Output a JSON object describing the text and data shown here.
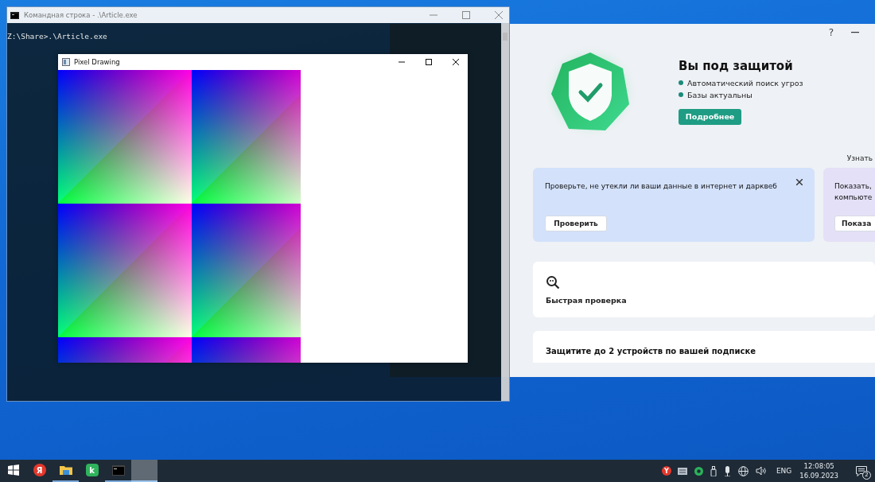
{
  "console_window": {
    "title": "Командная строка - .\\Article.exe",
    "lines": [
      "Z:\\Share>.\\Article.exe"
    ]
  },
  "drawing_window": {
    "title": "Pixel Drawing"
  },
  "security_app": {
    "help": "?",
    "status": {
      "title": "Вы под защитой",
      "bullets": [
        "Автоматический поиск угроз",
        "Базы актуальны"
      ],
      "button": "Подробнее"
    },
    "learn_more": "Узнать",
    "cards": [
      {
        "kind": "leak",
        "lines": [
          "Проверьте, не утекли ли ваши данные в интернет и дарквеб"
        ],
        "button": "Проверить",
        "closable": true
      },
      {
        "kind": "show",
        "lines": [
          "Показать,",
          "компьюте"
        ],
        "button": "Показа",
        "closable": false
      }
    ],
    "quick_scan": {
      "label": "Быстрая проверка"
    },
    "devices": {
      "title": "Защитите до 2 устройств по вашей подписке"
    }
  },
  "taskbar": {
    "apps": [
      {
        "kind": "start",
        "running": false,
        "selected": false
      },
      {
        "kind": "yandex",
        "glyph": "Я",
        "running": false,
        "selected": false
      },
      {
        "kind": "explorer",
        "running": true,
        "selected": false
      },
      {
        "kind": "kaspersky",
        "glyph": "k",
        "running": false,
        "selected": false
      },
      {
        "kind": "console",
        "running": true,
        "selected": false
      },
      {
        "kind": "window",
        "running": true,
        "selected": true
      }
    ],
    "tray": {
      "yandex_glyph": "Y",
      "language": "ENG",
      "time": "12:08:05",
      "date": "16.09.2023",
      "notifications": "2"
    }
  }
}
